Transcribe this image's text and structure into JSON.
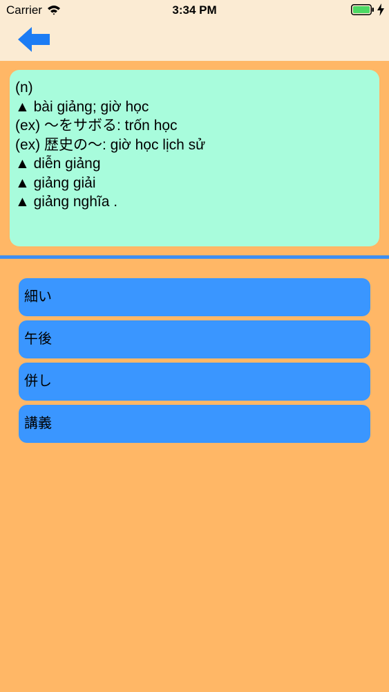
{
  "status_bar": {
    "carrier": "Carrier",
    "time": "3:34 PM",
    "icons": [
      "wifi-icon",
      "battery-icon",
      "charging-icon"
    ]
  },
  "nav": {
    "back_icon": "left-arrow-icon"
  },
  "definition": {
    "lines": [
      "(n)",
      "▲ bài giảng; giờ học",
      "(ex) ～をサボる: trốn học",
      "(ex) 歴史の～: giờ học lịch sử",
      "▲ diễn giảng",
      "▲ giảng giải",
      "▲ giảng nghĩa ."
    ]
  },
  "options": [
    {
      "label": "細い"
    },
    {
      "label": "午後"
    },
    {
      "label": "併し"
    },
    {
      "label": "講義"
    }
  ],
  "colors": {
    "background": "#ffb766",
    "topbar": "#fbebd3",
    "card": "#a8fcdc",
    "divider": "#3f8ff0",
    "option": "#3a96ff",
    "arrow": "#1c7cf4",
    "battery": "#4cd964"
  }
}
